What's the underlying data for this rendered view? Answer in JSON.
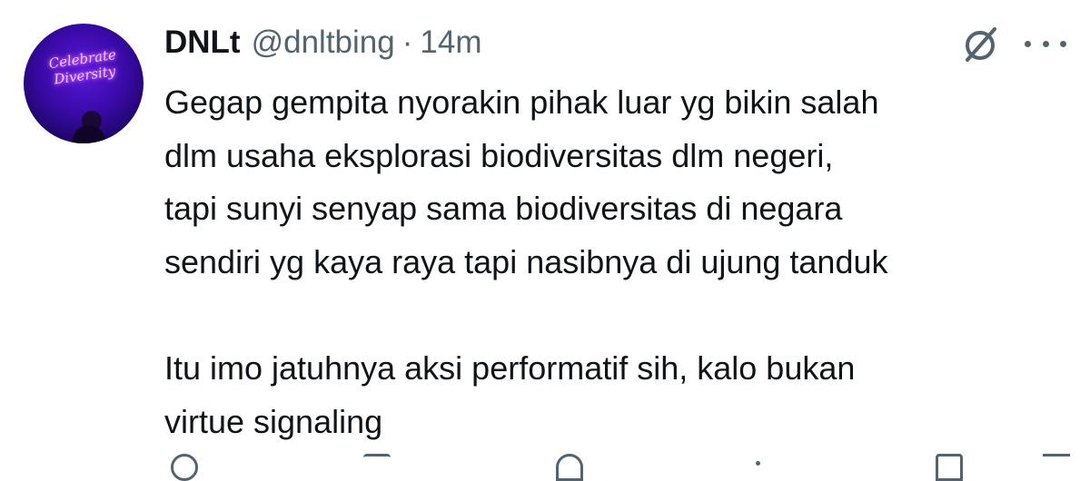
{
  "avatar": {
    "neon_text": "Celebrate\nDiversity"
  },
  "header": {
    "name": "DNLt",
    "handle": "@dnltbing",
    "separator": "·",
    "time": "14m"
  },
  "icons": {
    "grok": "grok-slash-circle-icon",
    "more": "more-dots-icon"
  },
  "tweet": {
    "text": "Gegap gempita nyorakin pihak luar yg bikin salah\ndlm usaha eksplorasi biodiversitas dlm negeri,\ntapi sunyi senyap sama biodiversitas di negara\nsendiri yg kaya raya tapi nasibnya di ujung tanduk\n\nItu imo jatuhnya aksi performatif sih, kalo bukan\nvirtue signaling"
  },
  "actions": [
    {
      "name": "reply-icon"
    },
    {
      "name": "retweet-icon"
    },
    {
      "name": "like-icon"
    },
    {
      "name": "views-icon"
    },
    {
      "name": "bookmark-icon"
    },
    {
      "name": "share-icon"
    }
  ],
  "colors": {
    "text": "#0f1419",
    "secondary": "#536471",
    "avatar_bg": "#3a0aa8"
  }
}
